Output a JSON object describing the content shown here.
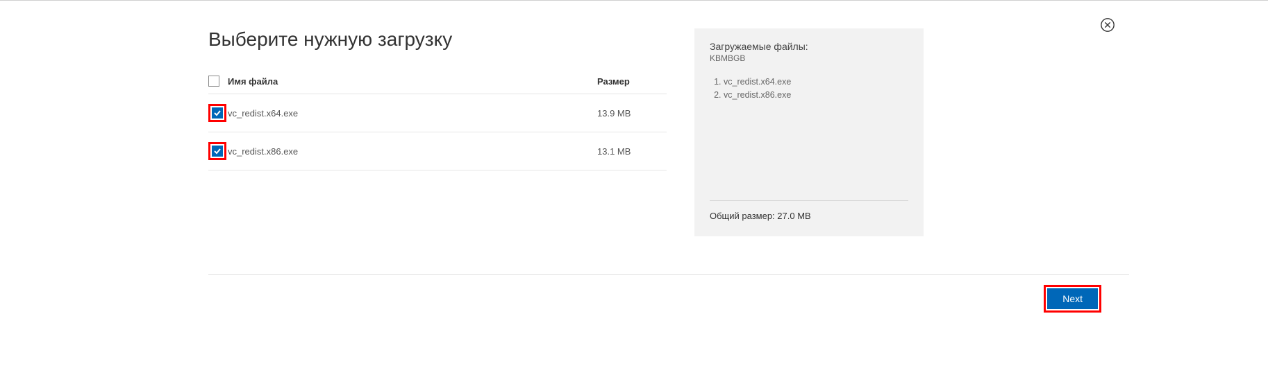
{
  "title": "Выберите нужную загрузку",
  "table": {
    "headers": {
      "name": "Имя файла",
      "size": "Размер"
    },
    "rows": [
      {
        "name": "vc_redist.x64.exe",
        "size": "13.9 MB",
        "checked": true
      },
      {
        "name": "vc_redist.x86.exe",
        "size": "13.1 MB",
        "checked": true
      }
    ]
  },
  "summary": {
    "title": "Загружаемые файлы:",
    "sub": "KBMBGB",
    "items": [
      "vc_redist.x64.exe",
      "vc_redist.x86.exe"
    ],
    "total_label": "Общий размер: 27.0 MB"
  },
  "buttons": {
    "next": "Next"
  }
}
